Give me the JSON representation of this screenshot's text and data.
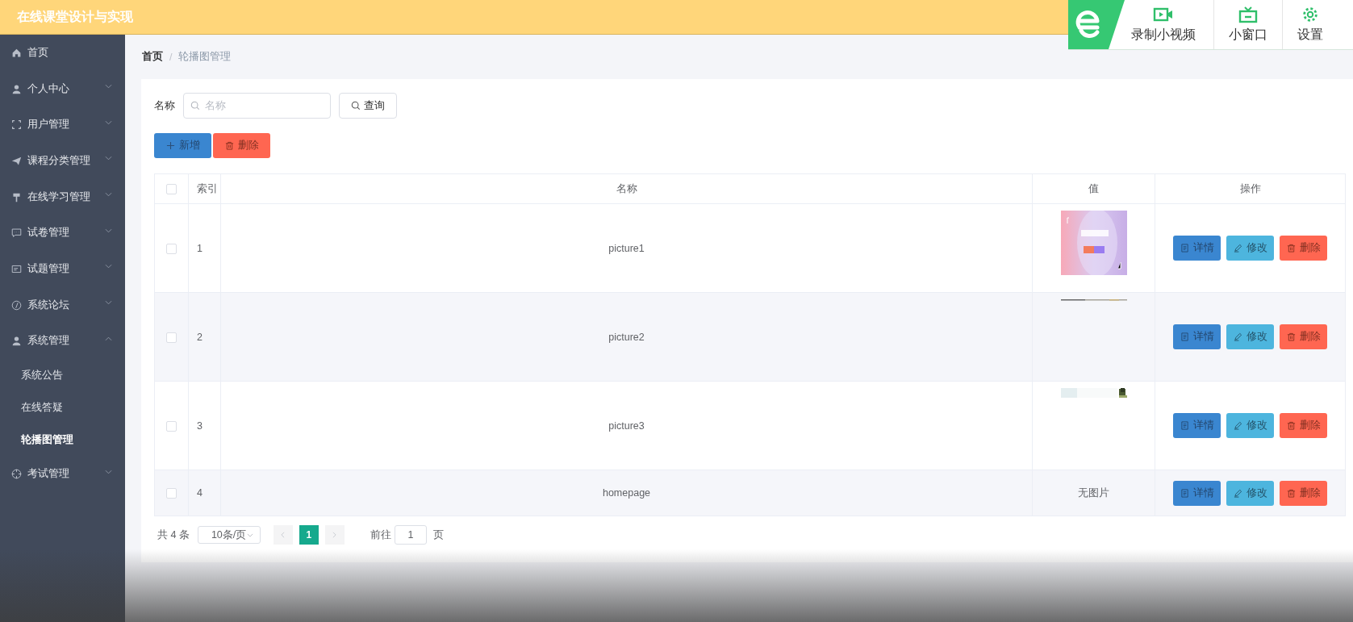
{
  "header": {
    "title": "在线课堂设计与实现"
  },
  "recorder_toolbar": {
    "items": [
      {
        "kind": "video",
        "label": "录制小视频"
      },
      {
        "kind": "tv",
        "label": "小窗口"
      },
      {
        "kind": "gear",
        "label": "设置"
      }
    ]
  },
  "sidebar": {
    "items": [
      {
        "label": "首页"
      },
      {
        "label": "个人中心",
        "expanded": false
      },
      {
        "label": "用户管理",
        "expanded": false
      },
      {
        "label": "课程分类管理",
        "expanded": false
      },
      {
        "label": "在线学习管理",
        "expanded": false
      },
      {
        "label": "试卷管理",
        "expanded": false
      },
      {
        "label": "试题管理",
        "expanded": false
      },
      {
        "label": "系统论坛",
        "expanded": false
      },
      {
        "label": "系统管理",
        "expanded": true,
        "children": [
          {
            "label": "系统公告",
            "selected": false
          },
          {
            "label": "在线答疑",
            "selected": false
          },
          {
            "label": "轮播图管理",
            "selected": true
          }
        ]
      },
      {
        "label": "考试管理",
        "expanded": false
      }
    ]
  },
  "breadcrumb": {
    "items": [
      "首页",
      "轮播图管理"
    ],
    "separator": "/"
  },
  "search": {
    "label": "名称",
    "placeholder": "名称",
    "button": "查询"
  },
  "actions": {
    "add": "新增",
    "delete": "删除"
  },
  "table": {
    "all_checked": false,
    "columns": [
      "索引",
      "名称",
      "值",
      "操作"
    ],
    "rows": [
      {
        "index": "1",
        "name": "picture1",
        "value": {
          "kind": "picture"
        },
        "checked": false,
        "buttons": [
          "详情",
          "修改",
          "删除"
        ]
      },
      {
        "index": "2",
        "name": "picture2",
        "value": {
          "kind": "picture"
        },
        "checked": false,
        "buttons": [
          "详情",
          "修改",
          "删除"
        ]
      },
      {
        "index": "3",
        "name": "picture3",
        "value": {
          "kind": "picture"
        },
        "checked": false,
        "buttons": [
          "详情",
          "修改",
          "删除"
        ]
      },
      {
        "index": "4",
        "name": "homepage",
        "value": {
          "kind": "text",
          "text": "无图片"
        },
        "checked": false,
        "buttons": [
          "详情",
          "修改",
          "删除"
        ]
      }
    ]
  },
  "pagination": {
    "total": "共 4 条",
    "page_size": "10条/页",
    "pages": [
      {
        "label": "1",
        "selected": true
      }
    ],
    "goto_label": "前往",
    "goto_value": "1",
    "goto_suffix": "页"
  }
}
